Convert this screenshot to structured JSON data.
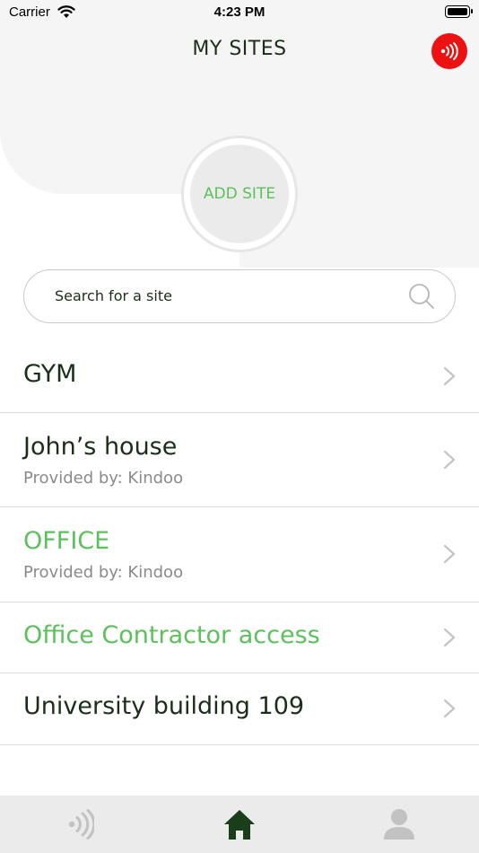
{
  "status_bar": {
    "carrier": "Carrier",
    "time": "4:23 PM"
  },
  "header": {
    "title": "MY SITES"
  },
  "add_site": {
    "label": "ADD SITE"
  },
  "search": {
    "placeholder": "Search for a site"
  },
  "sites": [
    {
      "name": "GYM",
      "provider": "",
      "highlighted": false
    },
    {
      "name": "John’s house",
      "provider": "Provided by: Kindoo",
      "highlighted": false
    },
    {
      "name": "OFFICE",
      "provider": "Provided by: Kindoo",
      "highlighted": true
    },
    {
      "name": "Office Contractor access",
      "provider": "",
      "highlighted": true
    },
    {
      "name": "University building 109",
      "provider": "",
      "highlighted": false
    }
  ],
  "tabs": [
    {
      "icon": "nfc-icon",
      "active": false
    },
    {
      "icon": "home-icon",
      "active": true
    },
    {
      "icon": "profile-icon",
      "active": false
    }
  ],
  "colors": {
    "accent_green": "#5cc05c",
    "dark_green": "#1a2e1a",
    "nfc_red": "#ee1111",
    "muted_gray": "#8a8a8a"
  }
}
